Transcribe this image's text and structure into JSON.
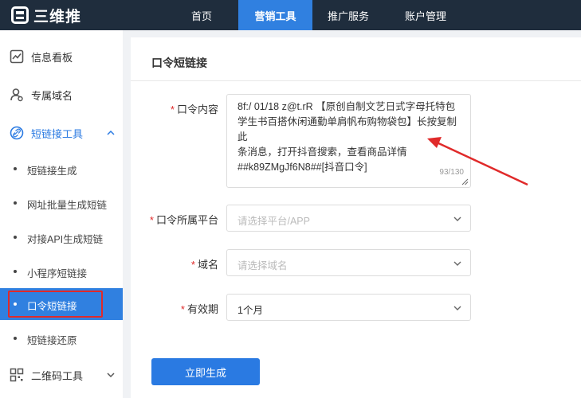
{
  "app": {
    "name": "三维推"
  },
  "topnav": [
    "首页",
    "营销工具",
    "推广服务",
    "账户管理"
  ],
  "sidebar": {
    "items": [
      {
        "label": "信息看板",
        "icon": "chart-icon"
      },
      {
        "label": "专属域名",
        "icon": "user-badge-icon"
      },
      {
        "label": "短链接工具",
        "icon": "link-icon",
        "expanded": true
      },
      {
        "label": "二维码工具",
        "icon": "qrcode-icon",
        "expanded": false
      }
    ],
    "subitems": [
      "短链接生成",
      "网址批量生成短链",
      "对接API生成短链",
      "小程序短链接",
      "口令短链接",
      "短链接还原"
    ]
  },
  "page": {
    "title": "口令短链接",
    "fields": {
      "content": {
        "label": "口令内容",
        "value_lines": [
          "8f:/ 01/18 z@t.rR 【原创自制文艺日式字母托特包",
          "学生书百搭休闲通勤单肩帆布购物袋包】长按复制此",
          "条消息，打开抖音搜索，查看商品详情",
          "##k89ZMgJf6N8##[抖音口令]"
        ],
        "counter": "93/130"
      },
      "platform": {
        "label": "口令所属平台",
        "placeholder": "请选择平台/APP"
      },
      "domain": {
        "label": "域名",
        "placeholder": "请选择域名"
      },
      "validity": {
        "label": "有效期",
        "value": "1个月"
      }
    },
    "submit_label": "立即生成"
  },
  "colors": {
    "accent": "#2a7ae2",
    "topbar": "#1f2d3d",
    "annotation": "#e02a2a"
  }
}
